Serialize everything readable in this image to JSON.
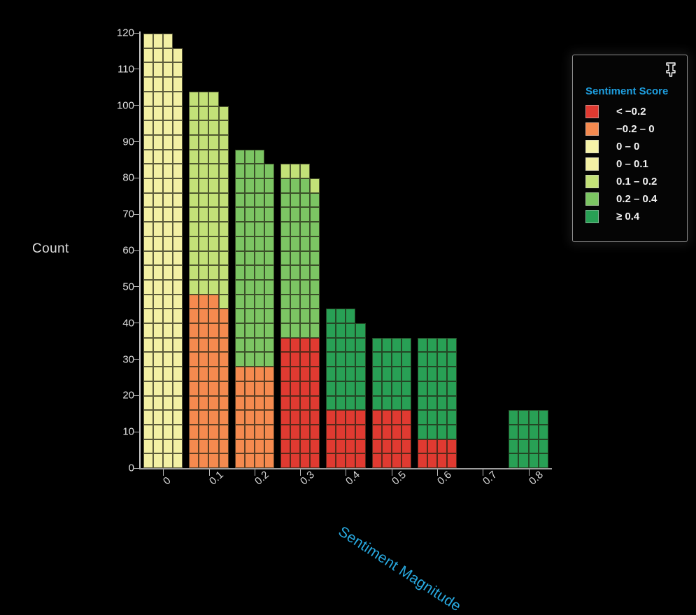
{
  "chart_data": {
    "type": "bar",
    "title": "",
    "subtitle": "",
    "xlabel": "Sentiment Magnitude",
    "ylabel": "Count",
    "xtick_labels": [
      "0",
      "0.1",
      "0.2",
      "0.3",
      "0.4",
      "0.5",
      "0.6",
      "0.7",
      "0.8"
    ],
    "ytick_labels": [
      "0",
      "10",
      "20",
      "30",
      "40",
      "50",
      "60",
      "70",
      "80",
      "90",
      "100",
      "110",
      "120"
    ],
    "ylim": [
      0,
      120
    ],
    "grid": false,
    "legend_position": "top-right",
    "stacked": true,
    "unit_cells": true,
    "cells_per_row": 4,
    "categories": [
      "0",
      "0.1",
      "0.2",
      "0.3",
      "0.4",
      "0.5",
      "0.6",
      "0.7",
      "0.8"
    ],
    "series": [
      {
        "name": "< −0.2",
        "color": "#e03a31",
        "values": [
          0,
          0,
          0,
          36,
          16,
          16,
          8,
          0,
          0
        ]
      },
      {
        "name": "−0.2 – 0",
        "color": "#f58a4f",
        "values": [
          0,
          47,
          28,
          0,
          0,
          0,
          0,
          0,
          0
        ]
      },
      {
        "name": "0 – 0",
        "color": "#f5f2a8",
        "values": [
          0,
          0,
          0,
          0,
          0,
          0,
          0,
          0,
          0
        ]
      },
      {
        "name": "0 – 0.1",
        "color": "#f3f0a4",
        "values": [
          119,
          0,
          0,
          0,
          0,
          0,
          0,
          0,
          0
        ]
      },
      {
        "name": "0.1 – 0.2",
        "color": "#c3e178",
        "values": [
          0,
          56,
          0,
          4,
          0,
          0,
          0,
          0,
          0
        ]
      },
      {
        "name": "0.2 – 0.4",
        "color": "#7cc563",
        "values": [
          0,
          0,
          59,
          43,
          0,
          0,
          0,
          0,
          0
        ]
      },
      {
        "name": "≥ 0.4",
        "color": "#28a055",
        "values": [
          0,
          0,
          0,
          0,
          27,
          20,
          28,
          0,
          16
        ]
      }
    ],
    "bar_totals": [
      119,
      103,
      87,
      83,
      43,
      36,
      36,
      0,
      16
    ],
    "segments_by_category": [
      [
        {
          "series": "0 – 0.1",
          "value": 119
        }
      ],
      [
        {
          "series": "−0.2 – 0",
          "value": 47
        },
        {
          "series": "0.1 – 0.2",
          "value": 56
        }
      ],
      [
        {
          "series": "−0.2 – 0",
          "value": 28
        },
        {
          "series": "0.2 – 0.4",
          "value": 59
        }
      ],
      [
        {
          "series": "< −0.2",
          "value": 36
        },
        {
          "series": "0.2 – 0.4",
          "value": 43
        },
        {
          "series": "0.1 – 0.2",
          "value": 4
        }
      ],
      [
        {
          "series": "< −0.2",
          "value": 16
        },
        {
          "series": "≥ 0.4",
          "value": 27
        }
      ],
      [
        {
          "series": "< −0.2",
          "value": 16
        },
        {
          "series": "≥ 0.4",
          "value": 20
        }
      ],
      [
        {
          "series": "< −0.2",
          "value": 8
        },
        {
          "series": "≥ 0.4",
          "value": 28
        }
      ],
      [],
      [
        {
          "series": "≥ 0.4",
          "value": 16
        }
      ]
    ]
  },
  "axes": {
    "y_title": "Count",
    "x_title": "Sentiment Magnitude",
    "x_title_color": "#28a9e0"
  },
  "legend": {
    "title": "Sentiment Score",
    "pin_icon": "pin-icon",
    "items": [
      {
        "label": "< −0.2",
        "color": "#e03a31"
      },
      {
        "label": "−0.2 – 0",
        "color": "#f58a4f"
      },
      {
        "label": "0 – 0",
        "color": "#f5f2a8"
      },
      {
        "label": "0 – 0.1",
        "color": "#f3f0a4"
      },
      {
        "label": "0.1 – 0.2",
        "color": "#c3e178"
      },
      {
        "label": "0.2 – 0.4",
        "color": "#7cc563"
      },
      {
        "label": "≥ 0.4",
        "color": "#28a055"
      }
    ]
  }
}
